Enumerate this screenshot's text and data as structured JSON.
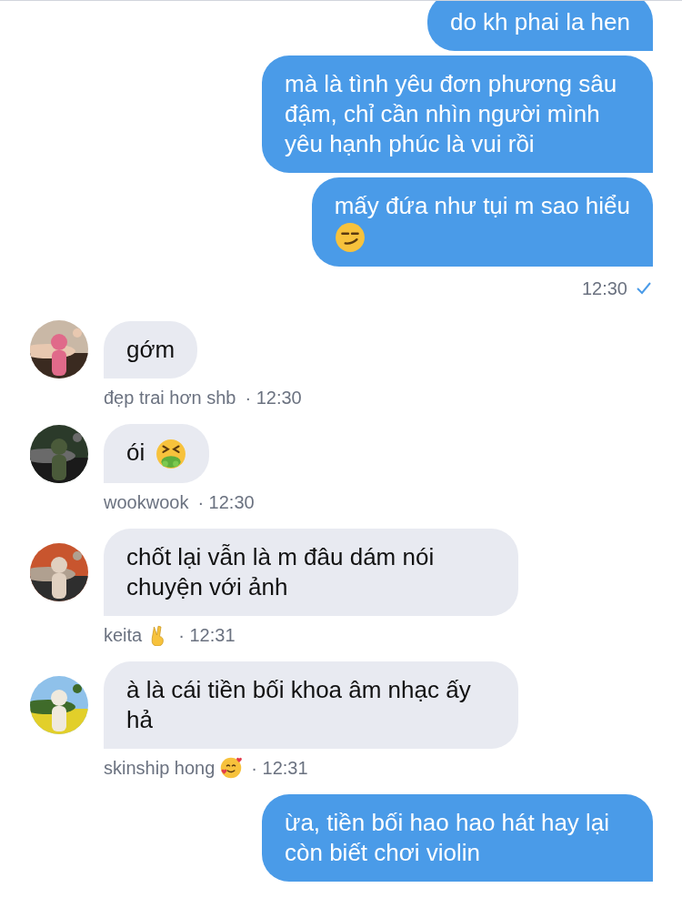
{
  "messages": [
    {
      "kind": "outgoing",
      "text": "do kh phai la hen"
    },
    {
      "kind": "outgoing",
      "text": "mà là tình yêu đơn phương sâu đậm, chỉ cần nhìn người mình yêu hạnh phúc là vui rồi"
    },
    {
      "kind": "outgoing",
      "text": "mấy đứa như tụi m sao hiểu",
      "trailing_icon": {
        "kind": "smirk"
      }
    },
    {
      "kind": "status",
      "time": "12:30",
      "read": true
    },
    {
      "kind": "incoming",
      "text": "gớm",
      "sender": "đẹp trai hơn shb",
      "time": "· 12:30"
    },
    {
      "kind": "incoming",
      "text": "ói",
      "trailing_icon": {
        "kind": "vomit"
      },
      "sender": "wookwook",
      "time": "· 12:30"
    },
    {
      "kind": "incoming",
      "text": "chốt lại vẫn là m đâu dám nói chuyện với ảnh",
      "sender": "keita",
      "sender_icon": {
        "kind": "victory"
      },
      "time": "· 12:31"
    },
    {
      "kind": "incoming",
      "text": "à là cái tiền bối khoa âm nhạc ấy hả",
      "sender": "skinship hong",
      "sender_icon": {
        "kind": "hearts"
      },
      "time": "· 12:31"
    },
    {
      "kind": "outgoing",
      "text": "ừa, tiền bối hao hao hát hay lại còn biết chơi violin"
    }
  ]
}
